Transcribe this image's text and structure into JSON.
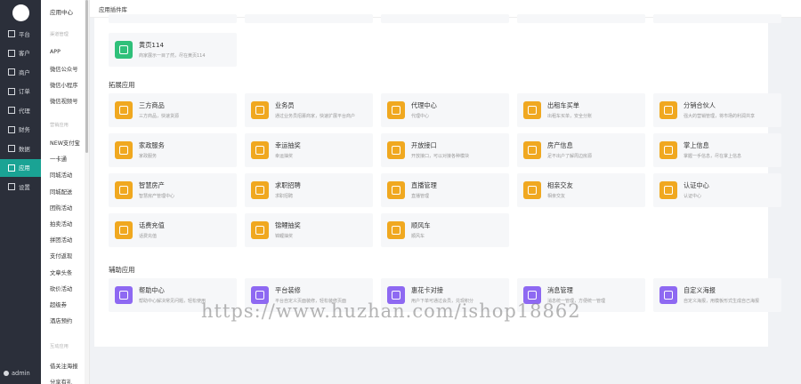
{
  "sidebar": {
    "items": [
      {
        "label": "平台",
        "icon": "monitor-icon"
      },
      {
        "label": "客户",
        "icon": "person-icon"
      },
      {
        "label": "商户",
        "icon": "users-icon"
      },
      {
        "label": "订单",
        "icon": "list-icon"
      },
      {
        "label": "代理",
        "icon": "agent-icon"
      },
      {
        "label": "财务",
        "icon": "finance-icon"
      },
      {
        "label": "数据",
        "icon": "chart-icon"
      },
      {
        "label": "应用",
        "icon": "app-icon",
        "active": true
      },
      {
        "label": "设置",
        "icon": "gear-icon"
      }
    ],
    "user": "admin"
  },
  "submenu": {
    "title": "应用中心",
    "group1": "渠道管理",
    "group1_items": [
      "APP",
      "微信公众号",
      "微信小程序",
      "微信视频号"
    ],
    "group2": "营销应用",
    "group2_items": [
      "NEW支付宝",
      "一卡通",
      "同城活动",
      "同城配送",
      "团购活动",
      "拍卖活动",
      "拼团活动",
      "支付返现",
      "文章头条",
      "砍价活动",
      "超级券",
      "酒店预约"
    ],
    "group3": "互动应用",
    "group3_items": [
      "借关注海报",
      "分享有礼"
    ]
  },
  "header": {
    "crumb": "应用插件库"
  },
  "yellow_page": {
    "name": "黄页114",
    "desc": "商家展示一目了然，尽在黄页114"
  },
  "section_expand": "拓展应用",
  "expand_apps": [
    {
      "name": "三方商品",
      "desc": "三方商品，快速货源"
    },
    {
      "name": "业务员",
      "desc": "通过业务员招募商家，快速扩展平台商户"
    },
    {
      "name": "代理中心",
      "desc": "代理中心"
    },
    {
      "name": "出租车买单",
      "desc": "出租车买单，安全分账"
    },
    {
      "name": "分销合伙人",
      "desc": "强大的营销管理，将市场的利润共享"
    },
    {
      "name": "家政服务",
      "desc": "家政服务"
    },
    {
      "name": "幸运抽奖",
      "desc": "幸运抽奖"
    },
    {
      "name": "开放接口",
      "desc": "开放接口，可以对接各种模块"
    },
    {
      "name": "房产信息",
      "desc": "足不出户了解周边房源"
    },
    {
      "name": "掌上信息",
      "desc": "掌握一手信息，尽在掌上信息"
    },
    {
      "name": "智慧房产",
      "desc": "智慧房产管理中心"
    },
    {
      "name": "求职招聘",
      "desc": "求职招聘"
    },
    {
      "name": "直播管理",
      "desc": "直播管理"
    },
    {
      "name": "相亲交友",
      "desc": "相亲交友"
    },
    {
      "name": "认证中心",
      "desc": "认证中心"
    },
    {
      "name": "话费充值",
      "desc": "话费充值"
    },
    {
      "name": "锦鲤抽奖",
      "desc": "锦鲤抽奖"
    },
    {
      "name": "顺风车",
      "desc": "顺风车"
    }
  ],
  "section_aux": "辅助应用",
  "aux_apps": [
    {
      "name": "帮助中心",
      "desc": "帮助中心解决常见问题，轻松使用"
    },
    {
      "name": "平台装修",
      "desc": "平台自定义页面装修，轻松装修页面"
    },
    {
      "name": "惠花卡对接",
      "desc": "用户下单可通过会员，兑现积分"
    },
    {
      "name": "消息管理",
      "desc": "消息统一管理，方便统一管理"
    },
    {
      "name": "自定义海报",
      "desc": "自定义海报，用模板形式生成自己海报"
    }
  ],
  "watermark": "https://www.huzhan.com/ishop18862",
  "colors": {
    "sidebar": "#2b2f3a",
    "active": "#1aa394",
    "orange": "#f0a820",
    "green": "#2fc07a",
    "purple": "#8e69f2"
  }
}
